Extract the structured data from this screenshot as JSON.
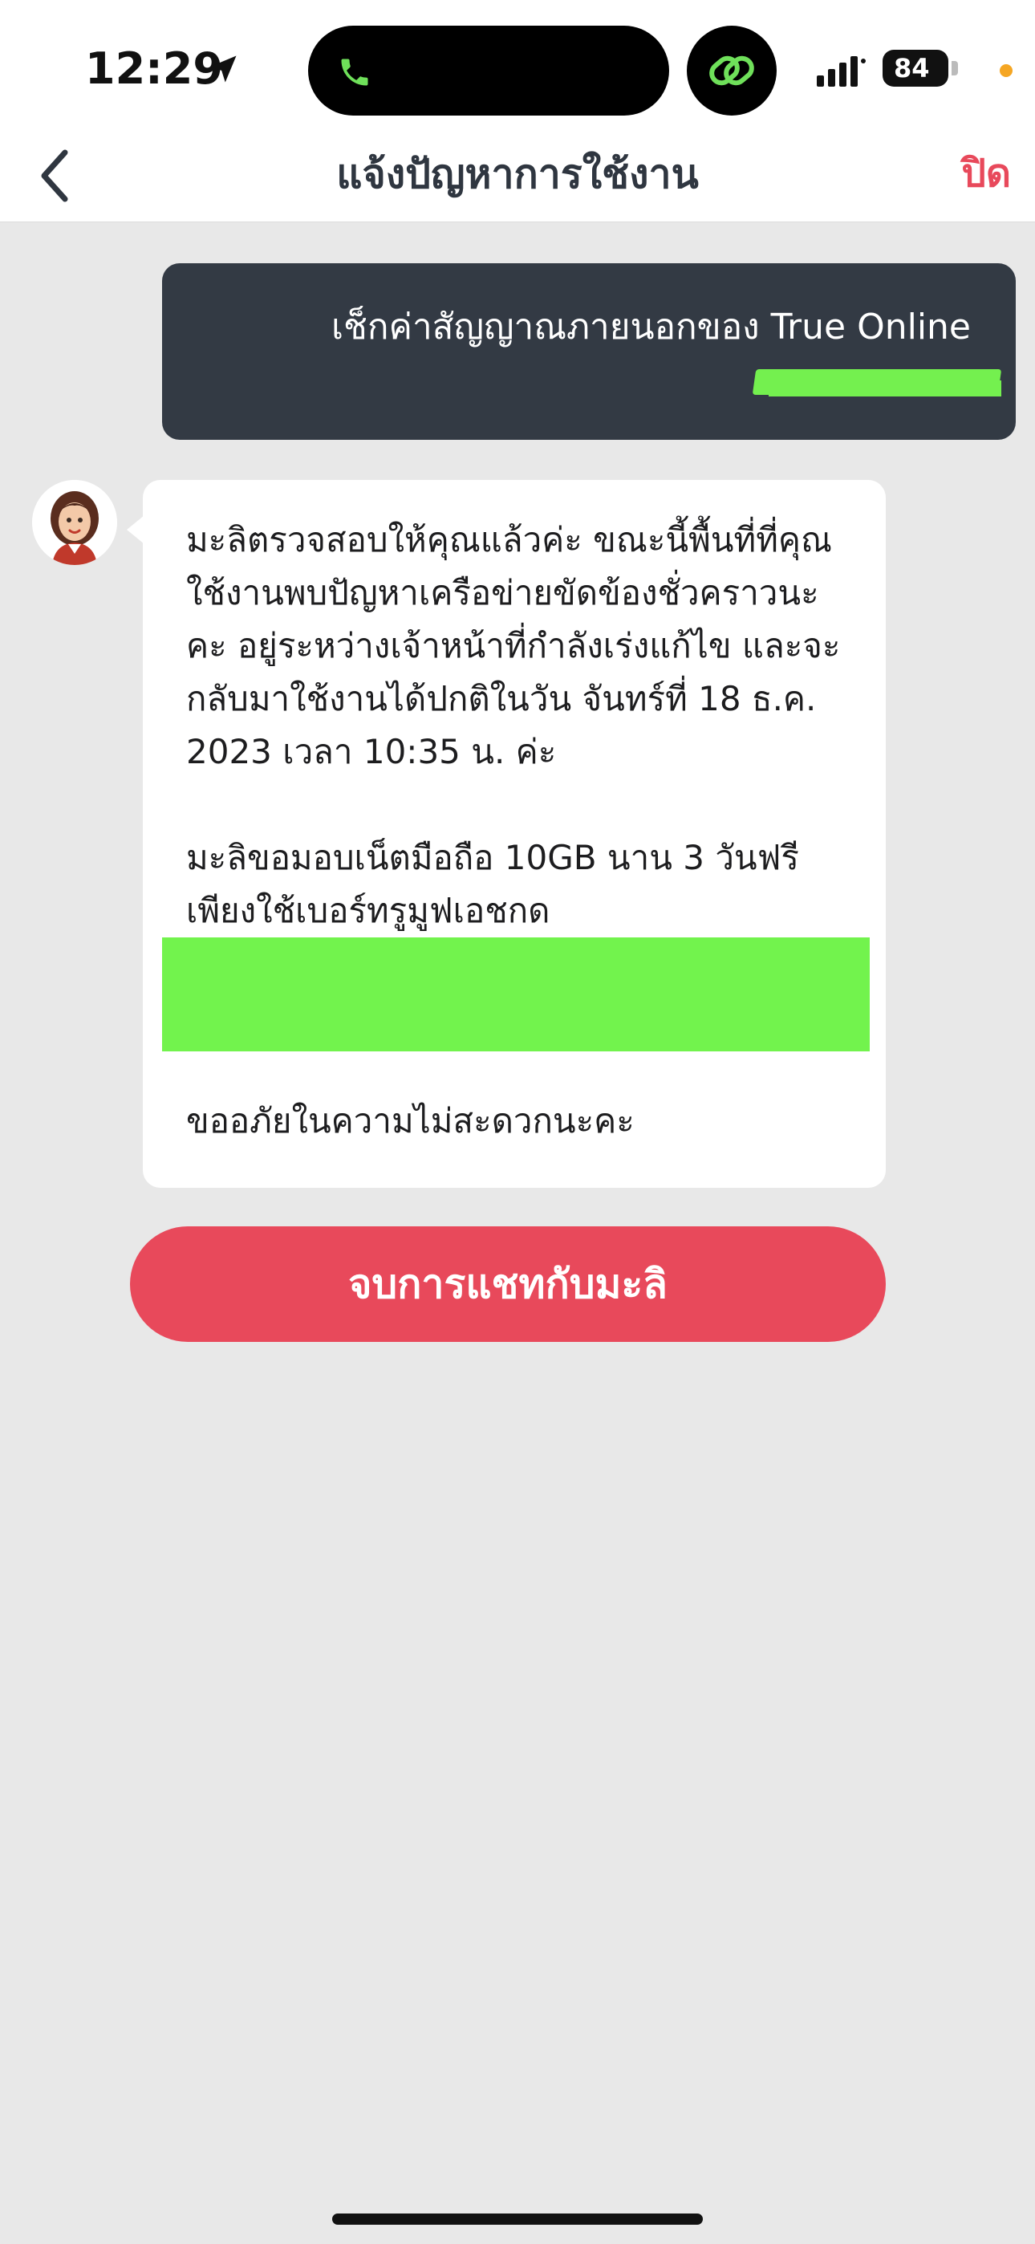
{
  "status_bar": {
    "time": "12:29",
    "battery": "84",
    "icons": [
      "location-arrow-icon",
      "phone-icon",
      "link-icon",
      "signal-icon",
      "battery-icon"
    ],
    "colors": {
      "island_accent": "#6fe05a",
      "privacy_dot": "#f5a623"
    }
  },
  "nav": {
    "title": "แจ้งปัญหาการใช้งาน",
    "close_label": "ปิด",
    "back_icon": "chevron-left-icon"
  },
  "chat": {
    "user_message": "เช็กค่าสัญญาณภายนอกของ True Online",
    "bot_message": {
      "paragraph1": "มะลิตรวจสอบให้คุณแล้วค่ะ ขณะนี้พื้นที่ที่คุณใช้งานพบปัญหาเครือข่ายขัดข้องชั่วคราวนะคะ อยู่ระหว่างเจ้าหน้าที่กำลังเร่งแก้ไข และจะกลับมาใช้งานได้ปกติในวัน จันทร์ที่ 18 ธ.ค. 2023 เวลา 10:35 น. ค่ะ",
      "paragraph2": "มะลิขอมอบเน็ตมือถือ 10GB นาน 3 วันฟรี เพียงใช้เบอร์ทรูมูฟเอชกด",
      "paragraph3": "ขออภัยในความไม่สะดวกนะคะ"
    },
    "end_chat_label": "จบการแชทกับมะลิ"
  },
  "colors": {
    "accent": "#e8495b",
    "user_bubble": "#333a44",
    "background": "#e8e8e8",
    "redaction": "#72f34d"
  }
}
